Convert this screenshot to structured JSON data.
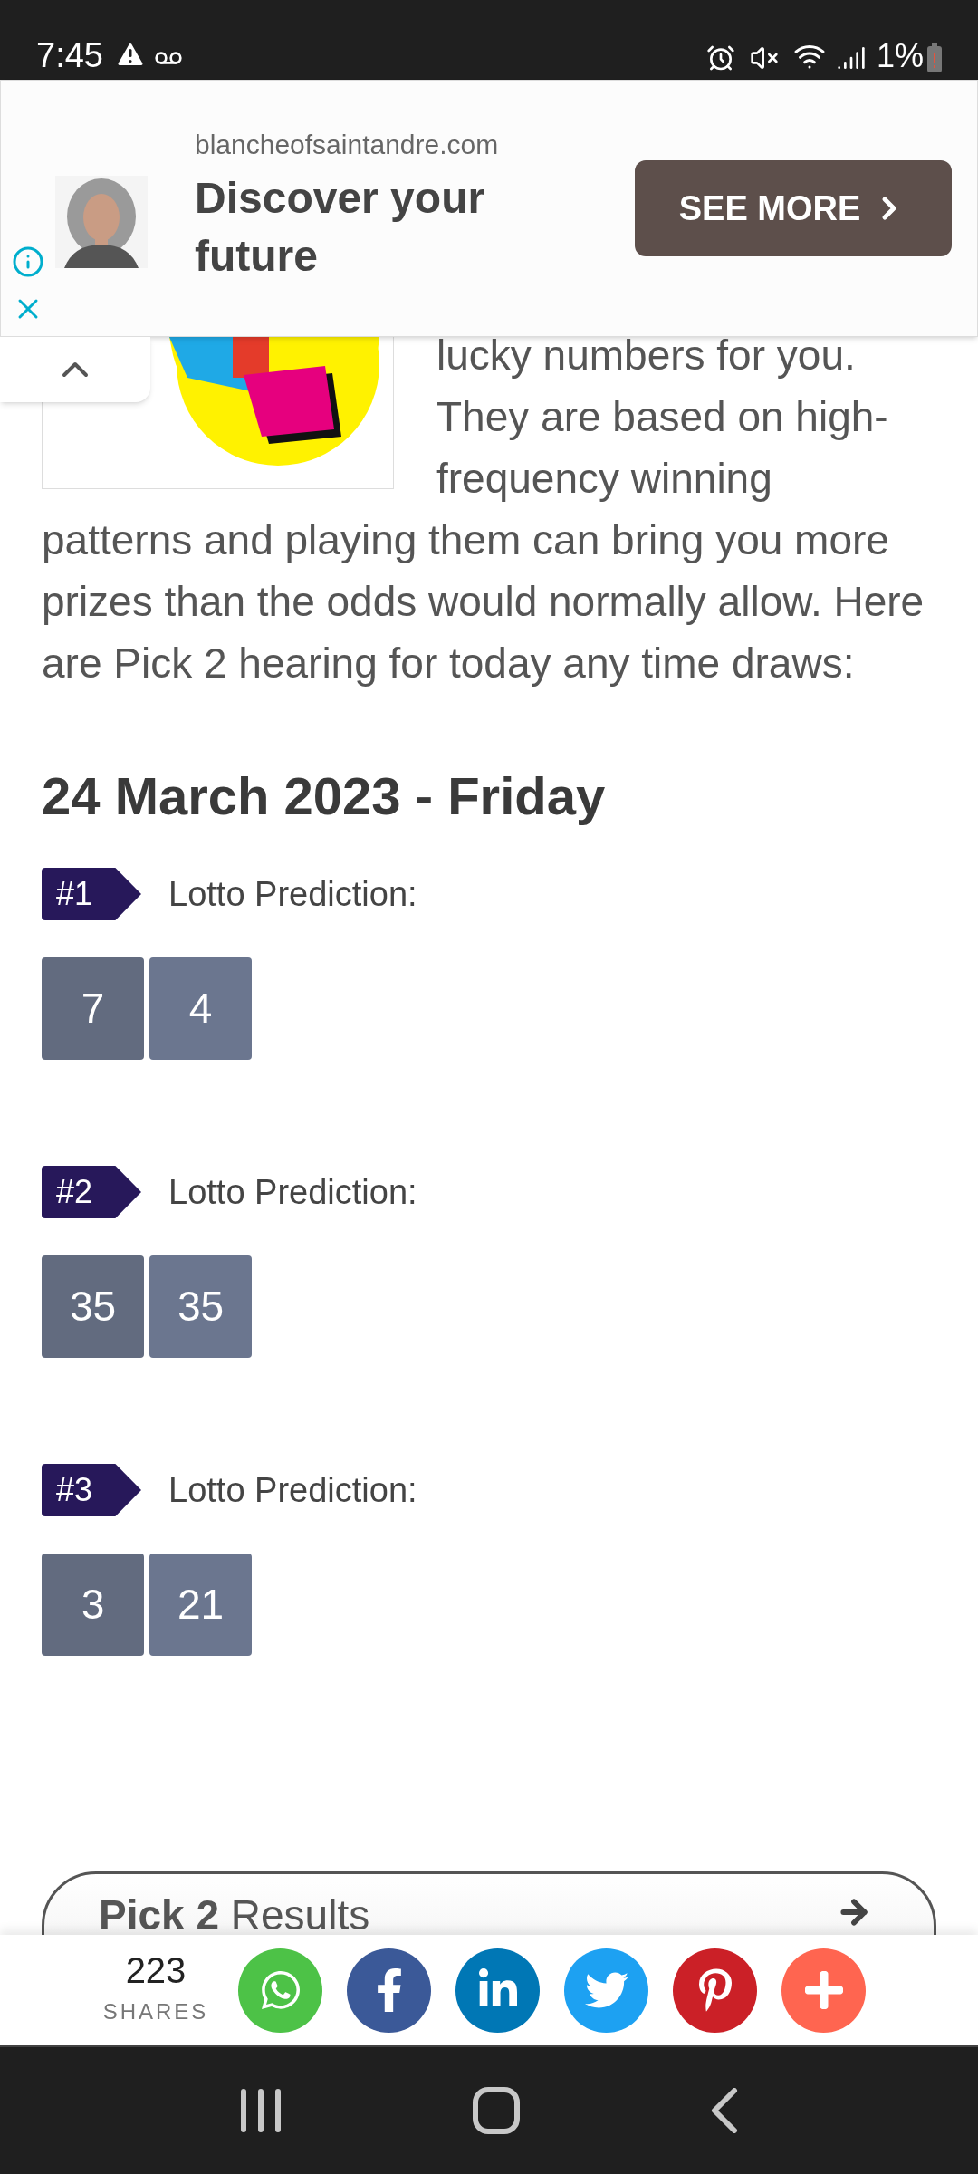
{
  "status_bar": {
    "time": "7:45",
    "battery": "1%"
  },
  "ad": {
    "domain": "blancheofsaintandre.com",
    "headline": "Discover your future",
    "button": "SEE MORE"
  },
  "article": {
    "intro_beside_image": "lucky numbers for you. They are based on high-frequency winning",
    "intro_continued": "patterns and playing them can bring you more prizes than the odds would normally allow. Here are Pick 2 hearing for today any time draws:",
    "date_heading": "24 March 2023 - Friday",
    "predictions": [
      {
        "badge": "#1",
        "label": "Lotto Prediction:",
        "numbers": [
          "7",
          "4"
        ]
      },
      {
        "badge": "#2",
        "label": "Lotto Prediction:",
        "numbers": [
          "35",
          "35"
        ]
      },
      {
        "badge": "#3",
        "label": "Lotto Prediction:",
        "numbers": [
          "3",
          "21"
        ]
      }
    ]
  },
  "results_card": {
    "title": "**Pick 2** Results"
  },
  "share_bar": {
    "count": "223",
    "label": "SHARES",
    "buttons": [
      {
        "kind": "whatsapp"
      },
      {
        "kind": "facebook"
      },
      {
        "kind": "linkedin"
      },
      {
        "kind": "twitter"
      },
      {
        "kind": "pinterest"
      },
      {
        "kind": "more"
      }
    ]
  }
}
